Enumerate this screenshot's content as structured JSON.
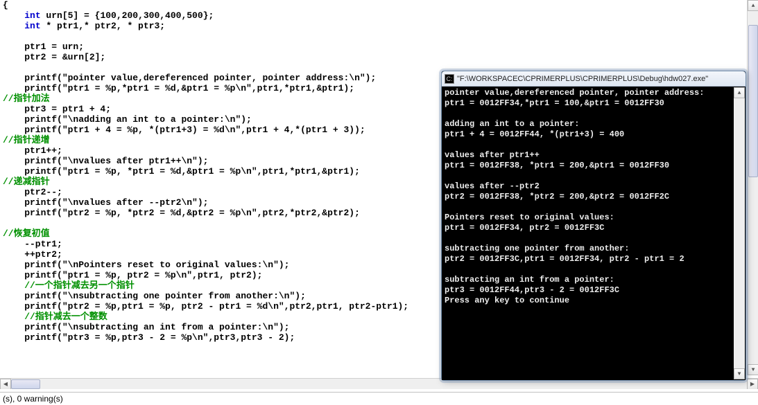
{
  "editor": {
    "lines": [
      {
        "t": "{",
        "cls": ""
      },
      {
        "t": "    int urn[5] = {100,200,300,400,500};",
        "kw": "int"
      },
      {
        "t": "    int * ptr1,* ptr2, * ptr3;",
        "kw": "int"
      },
      {
        "t": "",
        "cls": ""
      },
      {
        "t": "    ptr1 = urn;",
        "cls": ""
      },
      {
        "t": "    ptr2 = &urn[2];",
        "cls": ""
      },
      {
        "t": "",
        "cls": ""
      },
      {
        "t": "    printf(\"pointer value,dereferenced pointer, pointer address:\\n\");",
        "cls": ""
      },
      {
        "t": "    printf(\"ptr1 = %p,*ptr1 = %d,&ptr1 = %p\\n\",ptr1,*ptr1,&ptr1);",
        "cls": ""
      },
      {
        "t": "//指针加法",
        "cls": "cm"
      },
      {
        "t": "    ptr3 = ptr1 + 4;",
        "cls": ""
      },
      {
        "t": "    printf(\"\\nadding an int to a pointer:\\n\");",
        "cls": ""
      },
      {
        "t": "    printf(\"ptr1 + 4 = %p, *(ptr1+3) = %d\\n\",ptr1 + 4,*(ptr1 + 3));",
        "cls": ""
      },
      {
        "t": "//指针递增",
        "cls": "cm"
      },
      {
        "t": "    ptr1++;",
        "cls": ""
      },
      {
        "t": "    printf(\"\\nvalues after ptr1++\\n\");",
        "cls": ""
      },
      {
        "t": "    printf(\"ptr1 = %p, *ptr1 = %d,&ptr1 = %p\\n\",ptr1,*ptr1,&ptr1);",
        "cls": ""
      },
      {
        "t": "//递减指针",
        "cls": "cm"
      },
      {
        "t": "    ptr2--;",
        "cls": ""
      },
      {
        "t": "    printf(\"\\nvalues after --ptr2\\n\");",
        "cls": ""
      },
      {
        "t": "    printf(\"ptr2 = %p, *ptr2 = %d,&ptr2 = %p\\n\",ptr2,*ptr2,&ptr2);",
        "cls": ""
      },
      {
        "t": "",
        "cls": ""
      },
      {
        "t": "//恢复初值",
        "cls": "cm"
      },
      {
        "t": "    --ptr1;",
        "cls": ""
      },
      {
        "t": "    ++ptr2;",
        "cls": ""
      },
      {
        "t": "    printf(\"\\nPointers reset to original values:\\n\");",
        "cls": ""
      },
      {
        "t": "    printf(\"ptr1 = %p, ptr2 = %p\\n\",ptr1, ptr2);",
        "cls": ""
      },
      {
        "t": "    //一个指针减去另一个指针",
        "cls": "cm"
      },
      {
        "t": "    printf(\"\\nsubtracting one pointer from another:\\n\");",
        "cls": ""
      },
      {
        "t": "    printf(\"ptr2 = %p,ptr1 = %p, ptr2 - ptr1 = %d\\n\",ptr2,ptr1, ptr2-ptr1);",
        "cls": ""
      },
      {
        "t": "    //指针减去一个整数",
        "cls": "cm"
      },
      {
        "t": "    printf(\"\\nsubtracting an int from a pointer:\\n\");",
        "cls": ""
      },
      {
        "t": "    printf(\"ptr3 = %p,ptr3 - 2 = %p\\n\",ptr3,ptr3 - 2);",
        "cls": ""
      }
    ]
  },
  "console": {
    "title": "\"F:\\WORKSPACEC\\CPRIMERPLUS\\CPRIMERPLUS\\Debug\\hdw027.exe\"",
    "lines": [
      "pointer value,dereferenced pointer, pointer address:",
      "ptr1 = 0012FF34,*ptr1 = 100,&ptr1 = 0012FF30",
      "",
      "adding an int to a pointer:",
      "ptr1 + 4 = 0012FF44, *(ptr1+3) = 400",
      "",
      "values after ptr1++",
      "ptr1 = 0012FF38, *ptr1 = 200,&ptr1 = 0012FF30",
      "",
      "values after --ptr2",
      "ptr2 = 0012FF38, *ptr2 = 200,&ptr2 = 0012FF2C",
      "",
      "Pointers reset to original values:",
      "ptr1 = 0012FF34, ptr2 = 0012FF3C",
      "",
      "subtracting one pointer from another:",
      "ptr2 = 0012FF3C,ptr1 = 0012FF34, ptr2 - ptr1 = 2",
      "",
      "subtracting an int from a pointer:",
      "ptr3 = 0012FF44,ptr3 - 2 = 0012FF3C",
      "Press any key to continue"
    ]
  },
  "status": "(s), 0 warning(s)"
}
